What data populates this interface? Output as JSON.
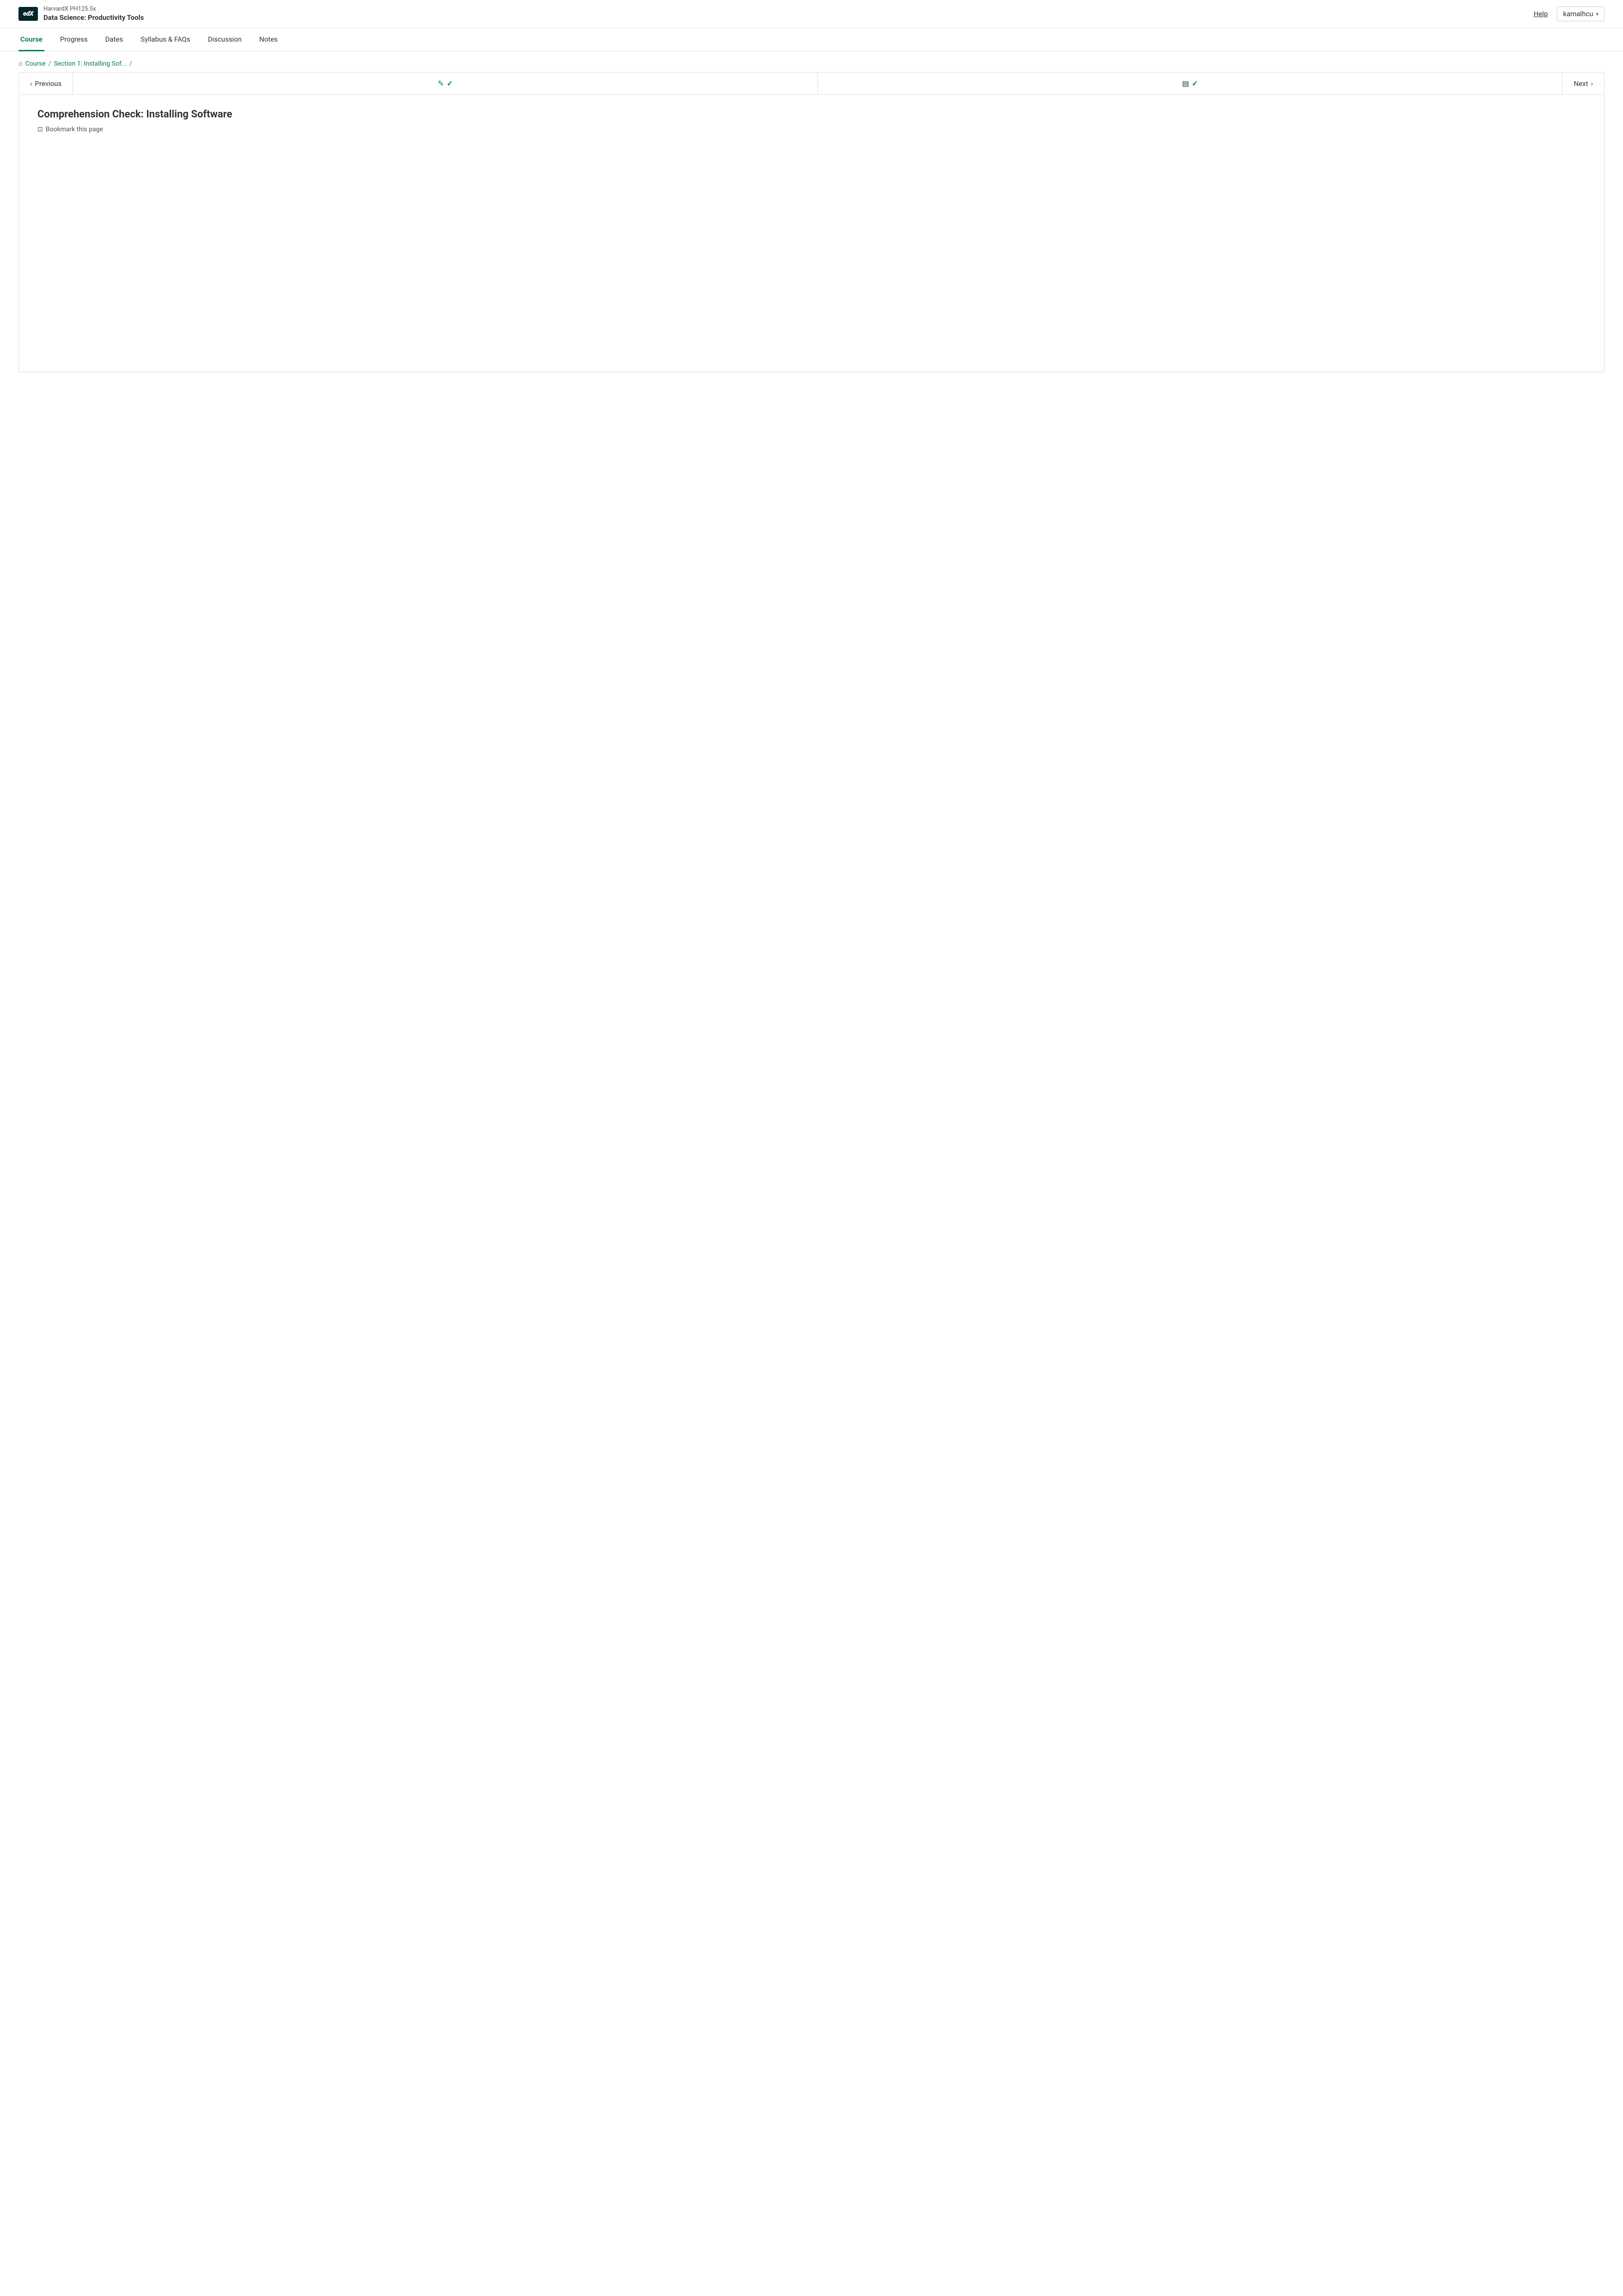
{
  "header": {
    "logo_text": "edX",
    "course_id": "HarvardX PH125.5x",
    "course_name": "Data Science: Productivity Tools",
    "help_label": "Help",
    "user_label": "kamalhcu",
    "user_chevron": "▾"
  },
  "nav": {
    "items": [
      {
        "id": "course",
        "label": "Course",
        "active": true
      },
      {
        "id": "progress",
        "label": "Progress",
        "active": false
      },
      {
        "id": "dates",
        "label": "Dates",
        "active": false
      },
      {
        "id": "syllabus",
        "label": "Syllabus & FAQs",
        "active": false
      },
      {
        "id": "discussion",
        "label": "Discussion",
        "active": false
      },
      {
        "id": "notes",
        "label": "Notes",
        "active": false
      }
    ]
  },
  "breadcrumb": {
    "home_icon": "⌂",
    "course_link": "Course",
    "section_link": "Section 1: Installing Sof...",
    "separator": "/"
  },
  "navbar": {
    "previous_label": "Previous",
    "next_label": "Next",
    "prev_chevron": "‹",
    "next_chevron": "›",
    "edit_icon": "✎",
    "book_icon": "▤",
    "check_icon": "✓"
  },
  "page": {
    "title": "Comprehension Check: Installing Software",
    "bookmark_label": "Bookmark this page",
    "bookmark_icon": "⊡"
  }
}
